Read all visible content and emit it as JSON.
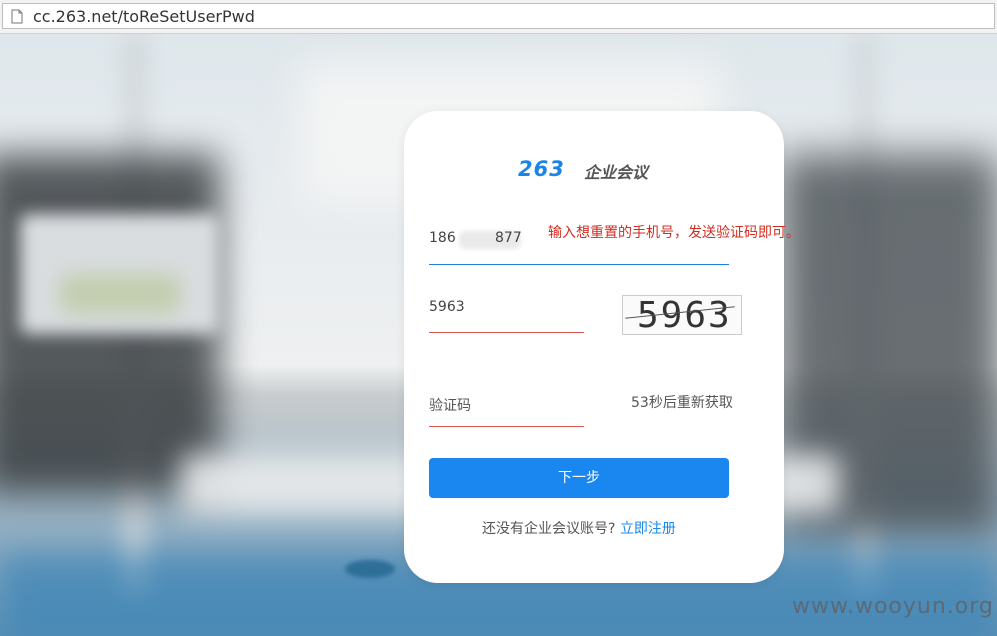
{
  "browser": {
    "url": "cc.263.net/toReSetUserPwd"
  },
  "card": {
    "logo_number": "263",
    "logo_text": "企业会议",
    "phone_prefix": "186",
    "phone_suffix": "877",
    "hint": "输入想重置的手机号，发送验证码即可。",
    "captcha_value": "5963",
    "captcha_image_text": "5963",
    "code_placeholder": "验证码",
    "countdown": "53秒后重新获取",
    "next_button": "下一步",
    "register_prompt": "还没有企业会议账号?",
    "register_link": "立即注册"
  },
  "watermark": "www.wooyun.org",
  "colors": {
    "accent": "#1a87f0",
    "hint": "#d12d22",
    "error_underline": "#d9534f"
  }
}
